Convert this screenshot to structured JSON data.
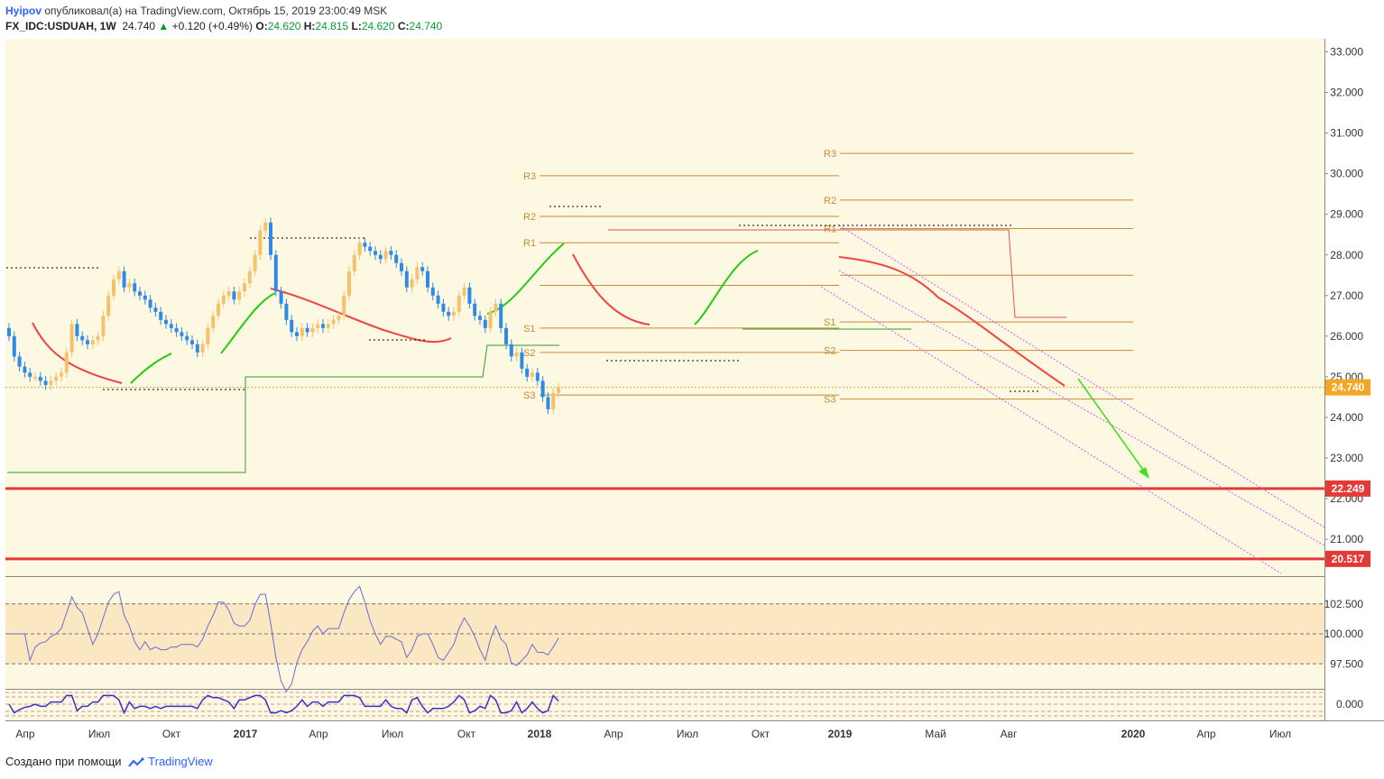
{
  "header": {
    "author": "Hyipov",
    "published_text": "опубликовал(а) на TradingView.com, Октябрь 15, 2019 23:00:49 MSK",
    "symbol": "FX_IDC:USDUAH, 1W",
    "last": "24.740",
    "change": "+0.120 (+0.49%)",
    "o_label": "O:",
    "o_value": "24.620",
    "h_label": "H:",
    "h_value": "24.815",
    "l_label": "L:",
    "l_value": "24.620",
    "c_label": "C:",
    "c_value": "24.740",
    "up_arrow": "▲"
  },
  "footer": {
    "created_with": "Создано при помощи",
    "brand": "TradingView"
  },
  "colors": {
    "pane_bg": "#fdf8e1",
    "up_candle": "#f5c16c",
    "down_candle": "#2e8ae6",
    "pivot": "#c98a37",
    "red_line": "#e53935",
    "green_stop": "#22cc11",
    "red_stop": "#ee4444",
    "channel": "#dd55ee",
    "cci": "#6a6ad8",
    "price_tag": "#f5a623"
  },
  "chart_data": {
    "type": "candlestick",
    "price_axis": {
      "ticks": [
        "33.000",
        "32.000",
        "31.000",
        "30.000",
        "29.000",
        "28.000",
        "27.000",
        "26.000",
        "25.000",
        "24.000",
        "23.000",
        "22.000",
        "21.000"
      ],
      "tick_values": [
        33,
        32,
        31,
        30,
        29,
        28,
        27,
        26,
        25,
        24,
        23,
        22,
        21
      ],
      "ylim": [
        20.5,
        33.25
      ]
    },
    "time_axis": {
      "labels": [
        "Апр",
        "Июл",
        "Окт",
        "2017",
        "Апр",
        "Июл",
        "Окт",
        "2018",
        "Апр",
        "Июл",
        "Окт",
        "2019",
        "Май",
        "Авг",
        "2020",
        "Апр",
        "Июл"
      ],
      "bold": [
        "2017",
        "2018",
        "2019",
        "2020"
      ]
    },
    "last_price": {
      "label": "24.740",
      "value": 24.74
    },
    "horizontal_levels": [
      {
        "label": "22.249",
        "value": 22.249
      },
      {
        "label": "20.517",
        "value": 20.517
      }
    ],
    "pivots_2018": {
      "R3": 29.95,
      "R2": 28.95,
      "R1": 28.3,
      "P": 27.25,
      "S1": 26.2,
      "S2": 25.6,
      "S3": 24.55
    },
    "pivots_2019": {
      "R3": 30.5,
      "R2": 29.35,
      "R1": 28.65,
      "P": 27.5,
      "S1": 26.35,
      "S2": 25.65,
      "S3": 24.45
    },
    "pivot_labels": [
      "R3",
      "R2",
      "R1",
      "S1",
      "S2",
      "S3"
    ],
    "weekly_close": [
      26.0,
      25.5,
      25.25,
      25.1,
      25.0,
      25.0,
      24.9,
      24.8,
      24.9,
      25.0,
      25.1,
      25.6,
      26.3,
      26.0,
      25.9,
      25.8,
      25.9,
      26.0,
      26.5,
      27.0,
      27.4,
      27.6,
      27.2,
      27.3,
      27.1,
      27.0,
      26.9,
      26.7,
      26.6,
      26.4,
      26.3,
      26.2,
      26.1,
      26.0,
      25.9,
      25.8,
      25.6,
      25.8,
      26.2,
      26.5,
      26.8,
      27.0,
      27.1,
      26.9,
      27.1,
      27.3,
      27.6,
      28.0,
      28.6,
      28.8,
      28.0,
      27.1,
      26.8,
      26.4,
      26.1,
      26.0,
      26.2,
      26.1,
      26.2,
      26.3,
      26.2,
      26.3,
      26.4,
      26.5,
      27.0,
      27.6,
      28.0,
      28.3,
      28.2,
      28.1,
      28.0,
      27.9,
      28.1,
      28.0,
      27.8,
      27.6,
      27.2,
      27.4,
      27.7,
      27.6,
      27.2,
      27.0,
      26.8,
      26.6,
      26.5,
      26.6,
      27.0,
      27.2,
      26.8,
      26.5,
      26.4,
      26.2,
      26.6,
      26.8,
      26.2,
      25.8,
      25.5,
      25.6,
      25.2,
      25.0,
      25.1,
      24.9,
      24.5,
      24.2,
      24.6,
      24.74
    ],
    "cci_axis": {
      "ticks": [
        "102.500",
        "100.000",
        "97.500"
      ],
      "tick_values": [
        102.5,
        100.0,
        97.5
      ],
      "ylim": [
        95.2,
        104.8
      ]
    },
    "lower_indicator": {
      "tick": "0.000",
      "tick_value": 0.0,
      "ylim": [
        -1.8,
        1.8
      ]
    }
  }
}
